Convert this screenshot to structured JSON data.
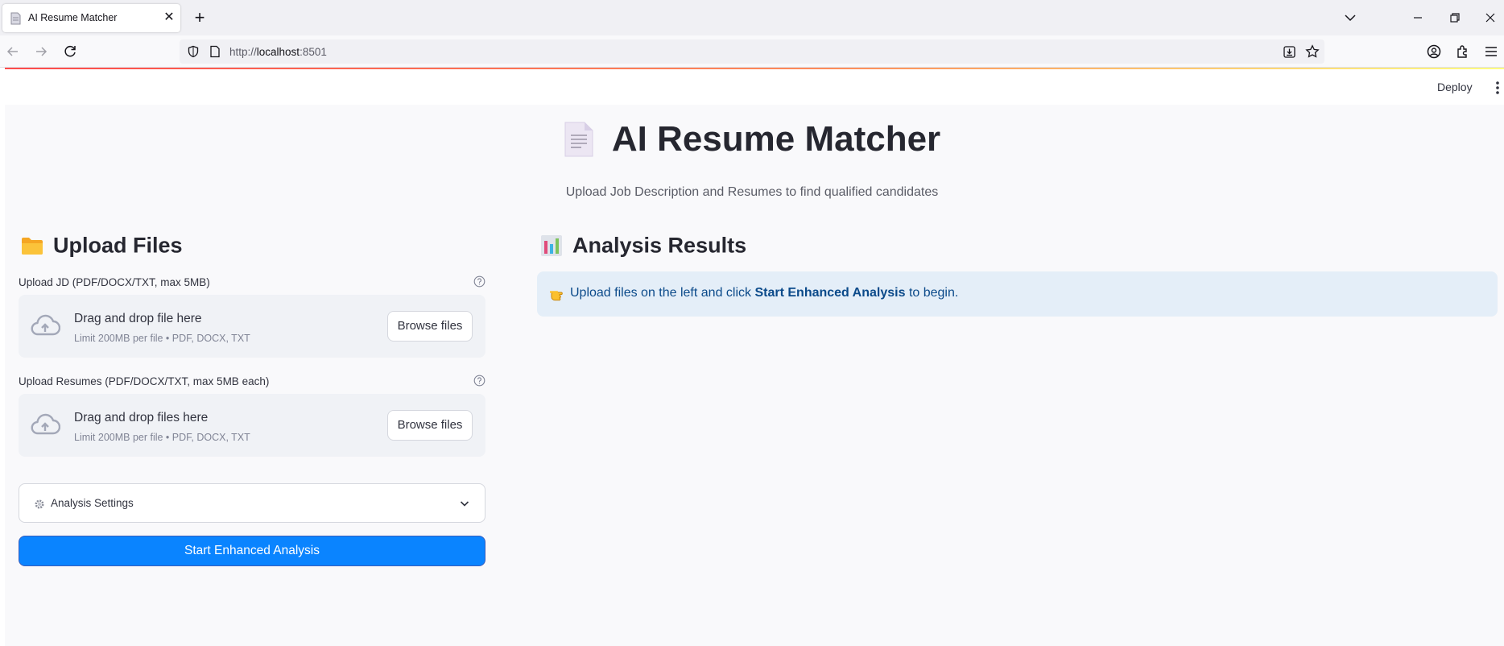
{
  "browser": {
    "tab_title": "AI Resume Matcher",
    "url_prefix": "http://",
    "url_host": "localhost",
    "url_port": ":8501"
  },
  "header": {
    "deploy_label": "Deploy"
  },
  "page": {
    "title": "AI Resume Matcher",
    "title_icon": "page-facing-up-emoji",
    "subtitle": "Upload Job Description and Resumes to find qualified candidates"
  },
  "upload": {
    "heading": "Upload Files",
    "heading_icon": "folder-emoji",
    "jd": {
      "label": "Upload JD (PDF/DOCX/TXT, max 5MB)",
      "drop_text": "Drag and drop file here",
      "limit_text": "Limit 200MB per file • PDF, DOCX, TXT",
      "browse_label": "Browse files"
    },
    "resumes": {
      "label": "Upload Resumes (PDF/DOCX/TXT, max 5MB each)",
      "drop_text": "Drag and drop files here",
      "limit_text": "Limit 200MB per file • PDF, DOCX, TXT",
      "browse_label": "Browse files"
    },
    "settings_label": "Analysis Settings",
    "start_button": "Start Enhanced Analysis"
  },
  "results": {
    "heading": "Analysis Results",
    "heading_icon": "bar-chart-emoji",
    "info_pre": "Upload files on the left and click ",
    "info_bold": "Start Enhanced Analysis",
    "info_post": " to begin.",
    "info_icon": "pointing-hand-emoji"
  },
  "colors": {
    "primary": "#0a84ff",
    "info_bg": "#e4eef8",
    "info_text": "#0b4a8a",
    "accent_line_start": "#ff4b4b",
    "accent_line_end": "#fffd80"
  }
}
